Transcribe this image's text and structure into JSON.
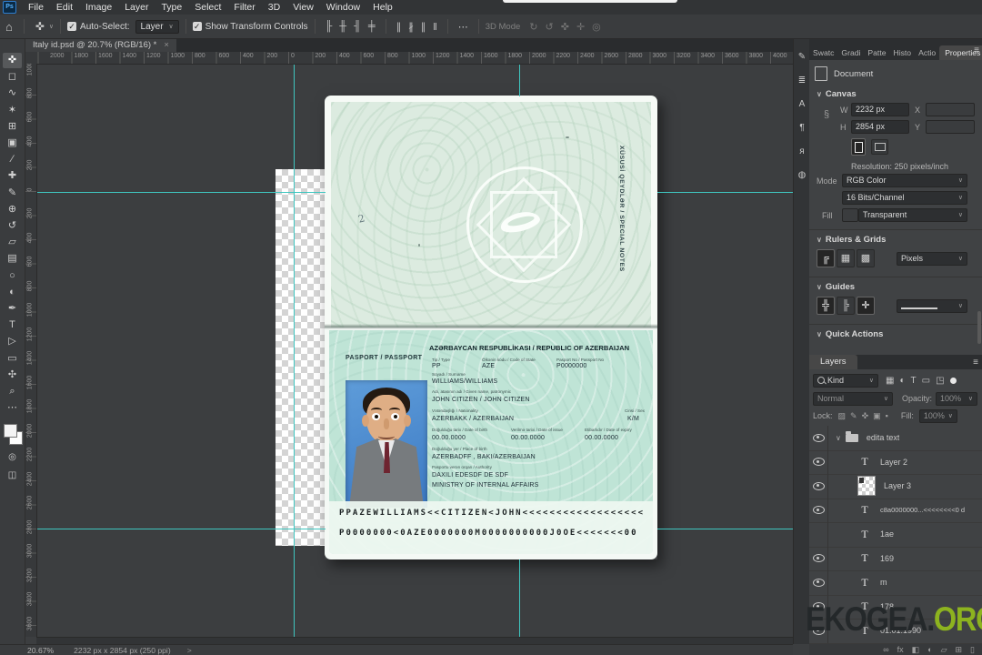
{
  "app": {
    "logo_text": "Ps",
    "menu": [
      "File",
      "Edit",
      "Image",
      "Layer",
      "Type",
      "Select",
      "Filter",
      "3D",
      "View",
      "Window",
      "Help"
    ]
  },
  "options_bar": {
    "home_icon": "⌂",
    "tool_icon": "✜",
    "auto_select_label": "Auto-Select:",
    "auto_select_value": "Layer",
    "show_transform_label": "Show Transform Controls",
    "more_icon": "⋯",
    "mode_3d_label": "3D Mode",
    "check_glyph": "✓",
    "chevron_glyph": "∨"
  },
  "document_tab": {
    "title": "Italy id.psd @ 20.7% (RGB/16) *",
    "close_glyph": "×"
  },
  "tools": [
    {
      "name": "move-tool",
      "glyph": "✜",
      "selected": true
    },
    {
      "name": "marquee-tool",
      "glyph": "◻"
    },
    {
      "name": "lasso-tool",
      "glyph": "∿"
    },
    {
      "name": "object-selection-tool",
      "glyph": "✶"
    },
    {
      "name": "crop-tool",
      "glyph": "⊞"
    },
    {
      "name": "frame-tool",
      "glyph": "▣"
    },
    {
      "name": "eyedropper-tool",
      "glyph": "∕"
    },
    {
      "name": "spot-healing-tool",
      "glyph": "✚"
    },
    {
      "name": "brush-tool",
      "glyph": "✎"
    },
    {
      "name": "clone-stamp-tool",
      "glyph": "⊕"
    },
    {
      "name": "history-brush-tool",
      "glyph": "↺"
    },
    {
      "name": "eraser-tool",
      "glyph": "▱"
    },
    {
      "name": "gradient-tool",
      "glyph": "▤"
    },
    {
      "name": "blur-tool",
      "glyph": "○"
    },
    {
      "name": "dodge-tool",
      "glyph": "◐"
    },
    {
      "name": "pen-tool",
      "glyph": "✒"
    },
    {
      "name": "type-tool",
      "glyph": "T"
    },
    {
      "name": "path-selection-tool",
      "glyph": "▷"
    },
    {
      "name": "rectangle-tool",
      "glyph": "▭"
    },
    {
      "name": "hand-tool",
      "glyph": "✣"
    },
    {
      "name": "zoom-tool",
      "glyph": "⌕"
    },
    {
      "name": "toolbar-more",
      "glyph": "⋯"
    }
  ],
  "rulers": {
    "h_labels": [
      2000,
      1800,
      1600,
      1400,
      1200,
      1000,
      800,
      600,
      400,
      200,
      0,
      200,
      400,
      600,
      800,
      1000,
      1200,
      1400,
      1600,
      1800,
      2000,
      2200,
      2400,
      2600,
      2800,
      3000,
      3200,
      3400,
      3600,
      3800,
      4000
    ],
    "v_labels": [
      1000,
      800,
      600,
      400,
      200,
      0,
      200,
      400,
      600,
      800,
      1000,
      1200,
      1400,
      1600,
      1800,
      2000,
      2200,
      2400,
      2600,
      2800,
      3000,
      3200,
      3400,
      3600
    ]
  },
  "canvas": {
    "guide_color": "#3fc6c0"
  },
  "passport": {
    "cover": {
      "vertical_text": "XÜSUSİ QEYDLƏR / SPECIAL NOTES",
      "handwritten_mark": "2"
    },
    "data_page": {
      "left_label": "PASPORT / PASSPORT",
      "title": "AZƏRBAYCAN RESPUBLİKASI  /  REPUBLIC OF AZERBAIJAN",
      "fields": [
        {
          "label": "Tip / Type",
          "value": "PP"
        },
        {
          "label": "Ölkənin kodu / Code of State",
          "value": "AZE"
        },
        {
          "label": "Pasport No / Passport No",
          "value": "P0000000"
        },
        {
          "label": "Soyadı / Surname",
          "value": "WILLIAMS/WILLIAMS"
        },
        {
          "label": "Adı, atasının adı / Given name, patronymic",
          "value": "JOHN CITIZEN / JOHN CITIZEN"
        },
        {
          "label": "Vətəndaşlığı / Nationality",
          "value": "AZERBAKK    / AZERBAIJAN"
        },
        {
          "label": "Cinsi / Sex",
          "value": "K/M"
        },
        {
          "label": "Doğulduğu tarix / Date of birth",
          "value": "00.00.0000"
        },
        {
          "label": "Verilmə tarixi / Date of issue",
          "value": "00.00.0000"
        },
        {
          "label": "Etibarlıdır / Date of expiry",
          "value": "00.00.0000"
        },
        {
          "label": "Doğulduğu yer / Place of birth",
          "value": "AZERBADFF , BAKI/AZERBAIJAN"
        },
        {
          "label": "Pasportu verən orqan / Authority",
          "value": "DAXILI EDESDF DE SDF"
        }
      ],
      "authority_line2": "MINISTRY OF INTERNAL AFFAIRS",
      "mrz_line1": "PPAZEWILLIAMS<<CITIZEN<JOHN<<<<<<<<<<<<<<<<<<",
      "mrz_line2": "P0000000<0AZE0000000M0000000000J0OE<<<<<<<00"
    }
  },
  "right_dock": {
    "panel_tabs": [
      {
        "label": "Swatc",
        "active": false
      },
      {
        "label": "Gradi",
        "active": false
      },
      {
        "label": "Patte",
        "active": false
      },
      {
        "label": "Histo",
        "active": false
      },
      {
        "label": "Actio",
        "active": false
      },
      {
        "label": "Properties",
        "active": true
      }
    ],
    "properties": {
      "document_label": "Document",
      "canvas_section": "Canvas",
      "w_label": "W",
      "w_value": "2232 px",
      "h_label": "H",
      "h_value": "2854 px",
      "x_label": "X",
      "y_label": "Y",
      "resolution": "Resolution: 250 pixels/inch",
      "mode_label": "Mode",
      "mode_value": "RGB Color",
      "depth_value": "16 Bits/Channel",
      "fill_label": "Fill",
      "fill_value": "Transparent",
      "rulers_grids_section": "Rulers & Grids",
      "units_value": "Pixels",
      "guides_section": "Guides",
      "quick_actions_section": "Quick Actions"
    },
    "layers": {
      "tab_label": "Layers",
      "filter_label": "Kind",
      "blend_mode": "Normal",
      "opacity_label": "Opacity:",
      "opacity_value": "100%",
      "lock_label": "Lock:",
      "fill_label": "Fill:",
      "fill_value": "100%",
      "items": [
        {
          "name": "edita text",
          "type": "group",
          "visible": true,
          "expanded": true
        },
        {
          "name": "Layer 2",
          "type": "text",
          "visible": true
        },
        {
          "name": "Layer 3",
          "type": "pixel",
          "visible": true
        },
        {
          "name": "c8a0000000...<<<<<<<<0 d",
          "type": "text",
          "visible": true
        },
        {
          "name": "1ae",
          "type": "text",
          "visible": false
        },
        {
          "name": "169",
          "type": "text",
          "visible": true
        },
        {
          "name": "m",
          "type": "text",
          "visible": true
        },
        {
          "name": "178",
          "type": "text",
          "visible": true
        },
        {
          "name": "01.01.1990",
          "type": "text",
          "visible": true
        }
      ]
    }
  },
  "status_bar": {
    "zoom": "20.67%",
    "dimensions": "2232 px x 2854 px (250 ppi)",
    "chevron": ">"
  },
  "watermark": {
    "dark": "EKOGEA.",
    "green": "ORG",
    "green_color": "#8db31f"
  },
  "icon_sets": {
    "align": [
      "╟",
      "╫",
      "╢",
      "╪"
    ],
    "distribute": [
      "∥",
      "∦",
      "∥",
      "‖"
    ],
    "three_d": [
      "↻",
      "↺",
      "✜",
      "✛",
      "◎"
    ],
    "collapsed_panels": [
      "✎",
      "≣",
      "A",
      "¶",
      "я",
      "◍"
    ],
    "layer_filters": [
      "▦",
      "◐",
      "T",
      "▭",
      "◳"
    ],
    "locks": [
      "▨",
      "✎",
      "✜",
      "▣",
      "▪"
    ],
    "footer": [
      "∞",
      "fx",
      "◧",
      "◐",
      "▱",
      "⊞",
      "▯"
    ],
    "ruler_grid_buttons": [
      "╔",
      "▦",
      "▩"
    ],
    "guide_buttons": [
      "╬",
      "╠",
      "✛"
    ]
  }
}
